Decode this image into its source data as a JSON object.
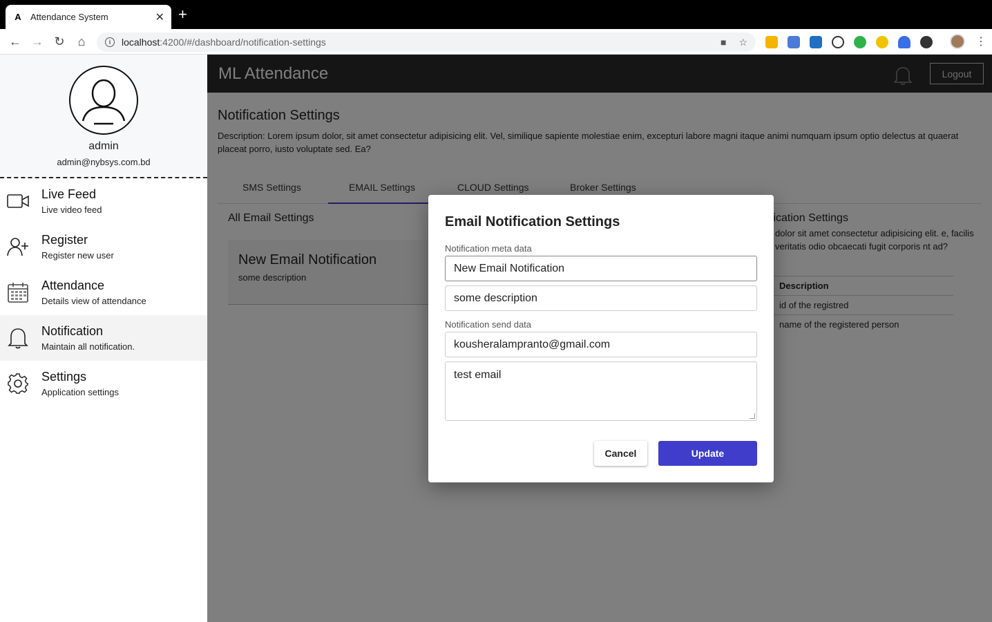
{
  "browser": {
    "tab_title": "Attendance System",
    "favicon": "A",
    "url_host": "localhost",
    "url_path": ":4200/#/dashboard/notification-settings"
  },
  "sidebar": {
    "username": "admin",
    "email": "admin@nybsys.com.bd",
    "items": [
      {
        "title": "Live Feed",
        "subtitle": "Live video feed",
        "icon": "video-camera-icon"
      },
      {
        "title": "Register",
        "subtitle": "Register new user",
        "icon": "add-user-icon"
      },
      {
        "title": "Attendance",
        "subtitle": "Details view of attendance",
        "icon": "calendar-icon"
      },
      {
        "title": "Notification",
        "subtitle": "Maintain all notification.",
        "icon": "bell-icon"
      },
      {
        "title": "Settings",
        "subtitle": "Application settings",
        "icon": "gear-icon"
      }
    ]
  },
  "appbar": {
    "title": "ML Attendance",
    "logout_label": "Logout"
  },
  "page": {
    "title": "Notification Settings",
    "description": "Description: Lorem ipsum dolor, sit amet consectetur adipisicing elit. Vel, similique sapiente molestiae enim, excepturi labore magni itaque animi numquam ipsum optio delectus at quaerat placeat porro, iusto voluptate sed. Ea?",
    "tabs": [
      "SMS Settings",
      "EMAIL Settings",
      "CLOUD Settings",
      "Broker Settings"
    ],
    "active_tab": "EMAIL Settings",
    "section_title": "All Email Settings",
    "card": {
      "title": "New Email Notification",
      "description": "some description"
    },
    "right_panel": {
      "title": "fication Settings",
      "description": "dolor sit amet consectetur adipisicing elit. e, facilis veritatis odio obcaecati fugit corporis nt ad?",
      "table_header": "Description",
      "rows": [
        "id of the registred",
        "name of the registered person"
      ]
    }
  },
  "dialog": {
    "title": "Email Notification Settings",
    "meta_label": "Notification meta data",
    "meta_name": "New Email Notification",
    "meta_description": "some description",
    "send_label": "Notification send data",
    "send_email": "kousheralampranto@gmail.com",
    "send_message": "test email",
    "cancel_label": "Cancel",
    "update_label": "Update"
  },
  "colors": {
    "accent": "#3f3dc9",
    "appbar": "#2b2b2b"
  }
}
